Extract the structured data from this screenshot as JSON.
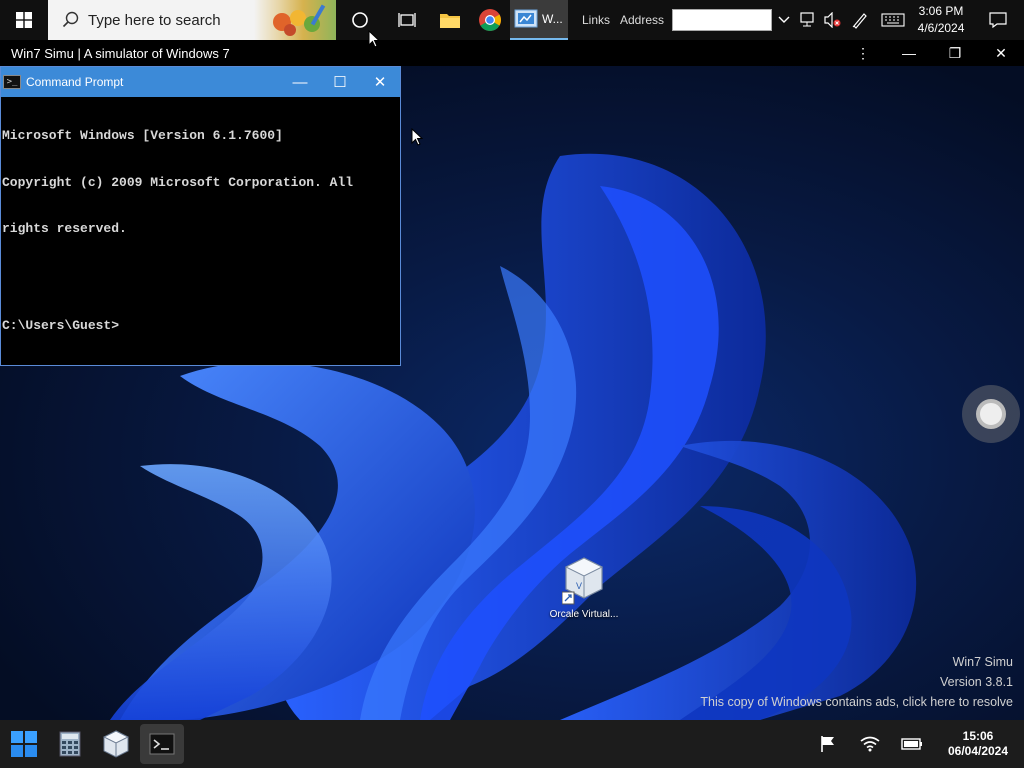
{
  "host_taskbar": {
    "search_placeholder": "Type here to search",
    "browser_tab_label": "W...",
    "links_label": "Links",
    "address_label": "Address",
    "address_value": "",
    "clock_time": "3:06 PM",
    "clock_date": "4/6/2024"
  },
  "app_window": {
    "title": "Win7 Simu | A simulator of Windows 7",
    "menu_glyph": "⋮",
    "minimize_glyph": "—",
    "restore_glyph": "❐",
    "close_glyph": "✕"
  },
  "cmd_window": {
    "title": "Command Prompt",
    "icon_glyph": ">_",
    "minimize_glyph": "—",
    "maximize_glyph": "☐",
    "close_glyph": "✕",
    "lines": [
      "Microsoft Windows [Version 6.1.7600]",
      "Copyright (c) 2009 Microsoft Corporation. All",
      "rights reserved.",
      "",
      "C:\\Users\\Guest>"
    ]
  },
  "desktop": {
    "icons": [
      {
        "label": "Orcale Virtual..."
      }
    ],
    "watermark": {
      "line1": "Win7 Simu",
      "line2": "Version 3.8.1",
      "line3": "This copy of Windows contains ads, click here to resolve"
    }
  },
  "win11_taskbar": {
    "apps": [
      "start-icon",
      "calculator-icon",
      "virtualbox-icon",
      "terminal-icon"
    ],
    "clock_time": "15:06",
    "clock_date": "06/04/2024"
  },
  "colors": {
    "accent": "#3c8ad8",
    "wallpaper_blue": "#1a52f0",
    "cmd_text": "#d8d8d8"
  }
}
